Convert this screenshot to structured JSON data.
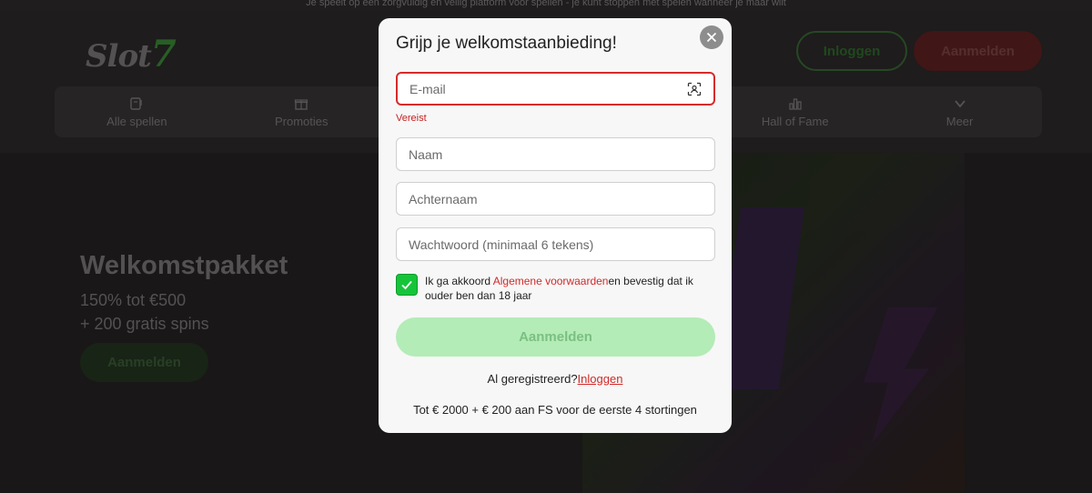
{
  "background": {
    "topbar_text": "Je speelt op een zorgvuldig en veilig platform voor spellen - je kunt stoppen met spelen wanneer je maar wilt",
    "logo_text": "Slot",
    "logo_digit": "7",
    "header": {
      "login_label": "Inloggen",
      "register_label": "Aanmelden"
    },
    "nav": [
      {
        "label": "Alle spellen",
        "icon": "slot-machine-icon"
      },
      {
        "label": "Promoties",
        "icon": "gift-icon"
      },
      {
        "label": "Hall of Fame",
        "icon": "bar-chart-icon"
      },
      {
        "label": "Meer",
        "icon": "chevron-down-icon"
      }
    ],
    "hero": {
      "title": "Welkomstpakket",
      "line1": "150% tot €500",
      "line2": "+ 200 gratis spins",
      "button_label": "Aanmelden"
    }
  },
  "modal": {
    "title": "Grijp je welkomstaanbieding!",
    "email": {
      "value": "",
      "placeholder": "E-mail",
      "error": "Vereist"
    },
    "first_name": {
      "value": "",
      "placeholder": "Naam"
    },
    "last_name": {
      "value": "",
      "placeholder": "Achternaam"
    },
    "password": {
      "value": "",
      "placeholder": "Wachtwoord (minimaal 6 tekens)"
    },
    "consent": {
      "checked": true,
      "text_before": "Ik ga akkoord ",
      "link_text": "Algemene voorwaarden",
      "text_after": "en bevestig dat ik ouder ben dan 18 jaar"
    },
    "submit_label": "Aanmelden",
    "registered_text": "Al geregistreerd?",
    "registered_link": "Inloggen",
    "promo_text": "Tot € 2000 + € 200 aan FS voor de eerste 4 stortingen"
  },
  "colors": {
    "accent_green": "#16c43a",
    "error_red": "#d62b2b",
    "link_red": "#d12a2a",
    "submit_disabled": "#b3ecb6"
  }
}
